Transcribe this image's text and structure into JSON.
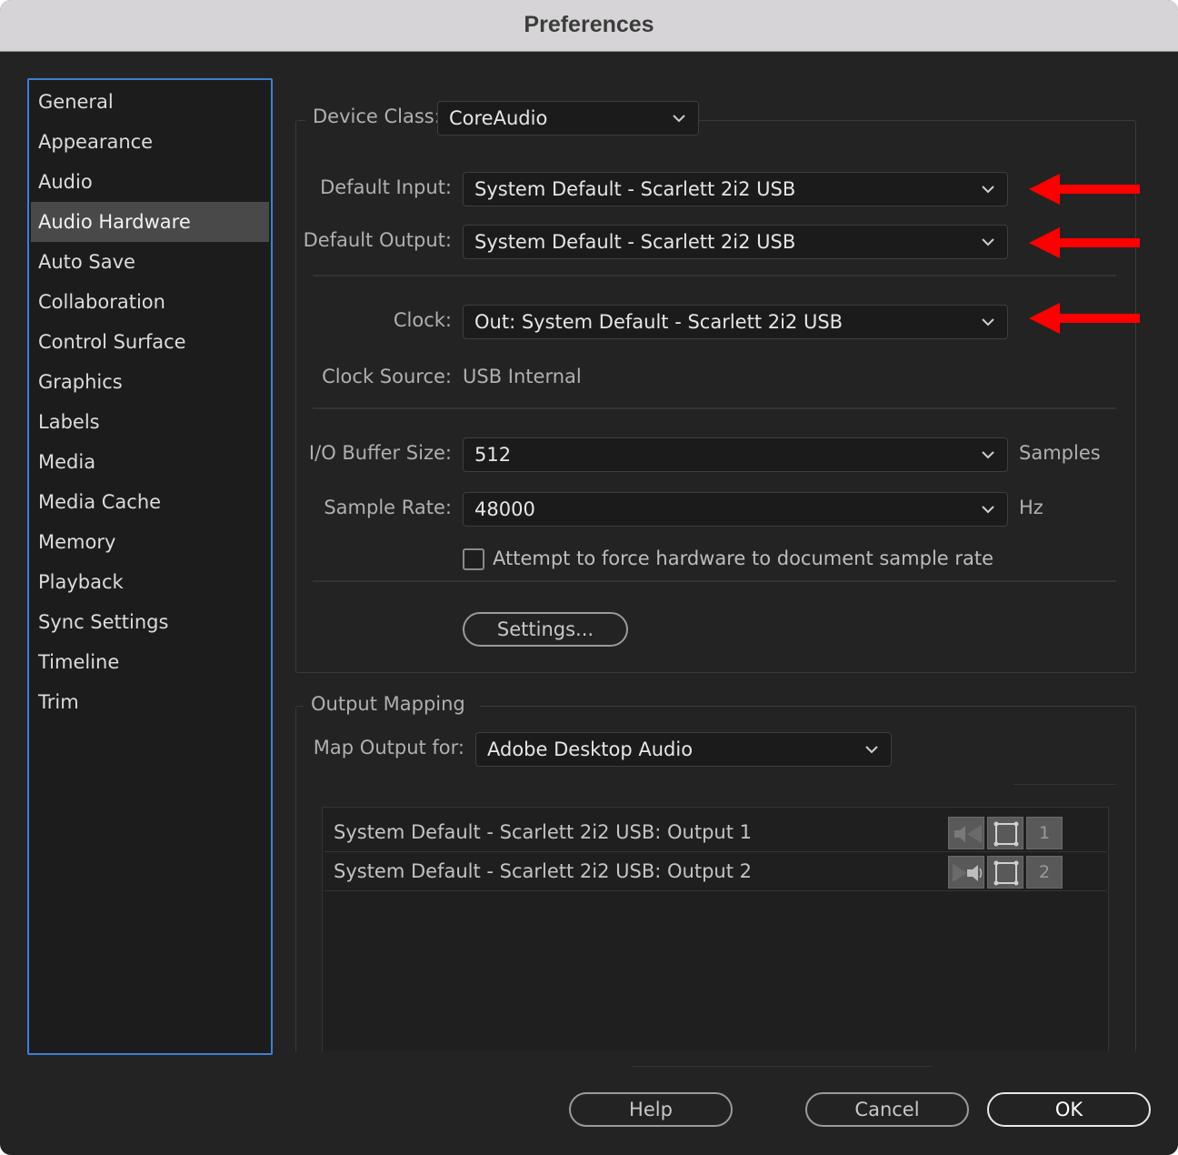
{
  "window": {
    "title": "Preferences"
  },
  "sidebar": {
    "items": [
      {
        "label": "General",
        "selected": false
      },
      {
        "label": "Appearance",
        "selected": false
      },
      {
        "label": "Audio",
        "selected": false
      },
      {
        "label": "Audio Hardware",
        "selected": true
      },
      {
        "label": "Auto Save",
        "selected": false
      },
      {
        "label": "Collaboration",
        "selected": false
      },
      {
        "label": "Control Surface",
        "selected": false
      },
      {
        "label": "Graphics",
        "selected": false
      },
      {
        "label": "Labels",
        "selected": false
      },
      {
        "label": "Media",
        "selected": false
      },
      {
        "label": "Media Cache",
        "selected": false
      },
      {
        "label": "Memory",
        "selected": false
      },
      {
        "label": "Playback",
        "selected": false
      },
      {
        "label": "Sync Settings",
        "selected": false
      },
      {
        "label": "Timeline",
        "selected": false
      },
      {
        "label": "Trim",
        "selected": false
      }
    ]
  },
  "hardware": {
    "device_class_label": "Device Class:",
    "device_class_value": "CoreAudio",
    "default_input_label": "Default Input:",
    "default_input_value": "System Default - Scarlett 2i2 USB",
    "default_output_label": "Default Output:",
    "default_output_value": "System Default - Scarlett 2i2 USB",
    "clock_label": "Clock:",
    "clock_value": "Out: System Default - Scarlett 2i2 USB",
    "clock_source_label": "Clock Source:",
    "clock_source_value": "USB Internal",
    "buffer_label": "I/O Buffer Size:",
    "buffer_value": "512",
    "buffer_unit": "Samples",
    "sample_rate_label": "Sample Rate:",
    "sample_rate_value": "48000",
    "sample_rate_unit": "Hz",
    "force_rate_label": "Attempt to force hardware to document sample rate",
    "force_rate_checked": false,
    "settings_button": "Settings..."
  },
  "output_mapping": {
    "group_label": "Output Mapping",
    "map_for_label": "Map Output for:",
    "map_for_value": "Adobe Desktop Audio",
    "rows": [
      {
        "label": "System Default - Scarlett 2i2 USB:  Output 1",
        "channel": "1"
      },
      {
        "label": "System Default - Scarlett 2i2 USB:  Output 2",
        "channel": "2"
      }
    ]
  },
  "footer": {
    "help": "Help",
    "cancel": "Cancel",
    "ok": "OK"
  },
  "colors": {
    "accent_border": "#3f7fd6",
    "annotation_arrow": "#ff0000",
    "selected_item": "#494949"
  },
  "icons": [
    "chevron-down-icon",
    "speaker-left-icon",
    "speaker-right-icon",
    "frame-icon",
    "red-arrow-icon"
  ]
}
